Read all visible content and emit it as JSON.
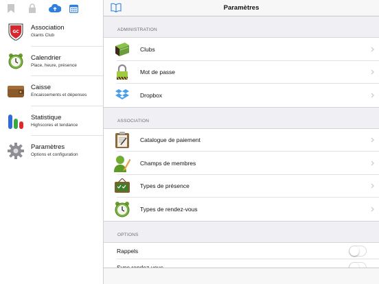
{
  "sidebar": {
    "toolbar": [
      {
        "icon": "bookmark-icon",
        "color": "#c7c7cc"
      },
      {
        "icon": "lock-icon",
        "color": "#c7c7cc"
      },
      {
        "icon": "cloud-upload-icon",
        "color": "#2f7fe0"
      },
      {
        "icon": "calendar-icon",
        "color": "#2f7fe0"
      }
    ],
    "items": [
      {
        "title": "Association",
        "subtitle": "Giants Club",
        "icon": "association-logo-icon"
      },
      {
        "title": "Calendrier",
        "subtitle": "Place, heure, présence",
        "icon": "alarm-clock-icon"
      },
      {
        "title": "Caisse",
        "subtitle": "Encaissements et dépenses",
        "icon": "wallet-icon"
      },
      {
        "title": "Statistique",
        "subtitle": "Highscores et tendance",
        "icon": "bar-chart-icon"
      },
      {
        "title": "Paramètres",
        "subtitle": "Options et configuration",
        "icon": "gear-icon"
      }
    ]
  },
  "main": {
    "title": "Paramètres",
    "sections": [
      {
        "header": "ADMINISTRATION",
        "rows": [
          {
            "label": "Clubs",
            "icon": "green-book-icon"
          },
          {
            "label": "Mot de passe",
            "icon": "padlock-icon"
          },
          {
            "label": "Dropbox",
            "icon": "dropbox-icon"
          }
        ]
      },
      {
        "header": "ASSOCIATION",
        "rows": [
          {
            "label": "Catalogue de paiement",
            "icon": "clipboard-icon"
          },
          {
            "label": "Champs de membres",
            "icon": "member-edit-icon"
          },
          {
            "label": "Types de présence",
            "icon": "attendance-board-icon"
          },
          {
            "label": "Types de rendez-vous",
            "icon": "alarm-clock-icon"
          }
        ]
      },
      {
        "header": "OPTIONS",
        "toggles": [
          {
            "label": "Rappels",
            "on": false
          },
          {
            "label": "Sync rendez-vous",
            "on": false
          }
        ]
      }
    ]
  },
  "colors": {
    "accent": "#2f7fe0",
    "background": "#efeff4"
  }
}
